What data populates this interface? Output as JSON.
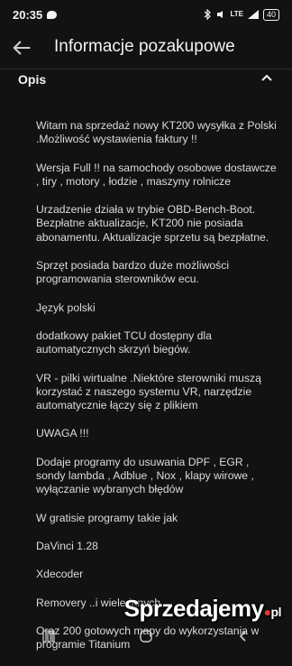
{
  "status_bar": {
    "time": "20:35",
    "network": "LTE",
    "battery": "40"
  },
  "header": {
    "title": "Informacje pozakupowe"
  },
  "section": {
    "title": "Opis"
  },
  "description": [
    "Witam na sprzedaż nowy KT200 wysyłka z Polski .Możliwość wystawienia faktury !!",
    "Wersja Full !! na samochody osobowe dostawcze , tiry , motory , łodzie , maszyny rolnicze",
    "Urzadzenie działa w trybie OBD-Bench-Boot. Bezpłatne aktualizacje, KT200 nie posiada abonamentu. Aktualizacje sprzetu są bezpłatne.",
    "Sprzęt posiada bardzo duże możliwości programowania sterowników ecu.",
    "Język polski",
    "dodatkowy pakiet TCU dostępny dla automatycznych skrzyń biegów.",
    "VR - pilki wirtualne .Niektóre sterowniki muszą korzystać z naszego systemu VR, narzędzie automatycznie łączy się z plikiem",
    "UWAGA !!!",
    "Dodaje programy do usuwania DPF , EGR , sondy lambda , Adblue , Nox , klapy wirowe , wyłączanie wybranych błędów",
    "W gratisie programy takie jak",
    "DaVinci 1.28",
    "Xdecoder",
    "Removery ..i wiele innych",
    "Oraz 200 gotowych mapy do wykorzystania w programie Titanium"
  ],
  "watermark": {
    "brand": "Sprzedajemy",
    "tld": "pl"
  }
}
